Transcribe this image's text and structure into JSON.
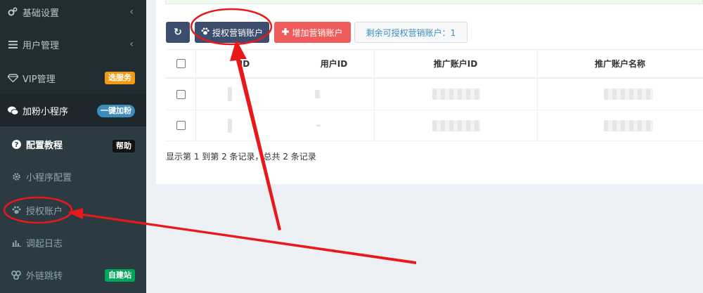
{
  "sidebar": {
    "items": [
      {
        "label": "基础设置",
        "icon": "gears-icon",
        "chevron": "‹"
      },
      {
        "label": "用户管理",
        "icon": "list-icon",
        "chevron": "‹"
      },
      {
        "label": "VIP管理",
        "icon": "diamond-icon",
        "badge": "选服务"
      },
      {
        "label": "加粉小程序",
        "icon": "wechat-icon",
        "badge": "一键加粉"
      }
    ],
    "sub_items": [
      {
        "label": "配置教程",
        "icon": "question-icon",
        "badge": "帮助"
      },
      {
        "label": "小程序配置",
        "icon": "gear-icon"
      },
      {
        "label": "授权账户",
        "icon": "paw-icon"
      },
      {
        "label": "调起日志",
        "icon": "bar-chart-icon"
      },
      {
        "label": "外链跳转",
        "icon": "link-icon",
        "badge": "自建站"
      }
    ]
  },
  "toolbar": {
    "refresh_icon": "↻",
    "auth_label": "授权营销账户",
    "add_label": "增加营销账户",
    "remaining_label": "剩余可授权营销账户：1"
  },
  "table": {
    "columns": [
      "ID",
      "用户ID",
      "推广账户ID",
      "推广账户名称"
    ],
    "rows": [
      {
        "id": "",
        "user_id": "",
        "account_id": "",
        "account_name": ""
      },
      {
        "id": "",
        "user_id": "",
        "account_id": "",
        "account_name": ""
      }
    ]
  },
  "footer": {
    "summary": "显示第 1 到第 2 条记录，总共 2 条记录"
  },
  "colors": {
    "sidebar_bg": "#222d32",
    "primary_button": "#3d4d6d",
    "danger_button": "#f05b5b",
    "annotation_red": "#e8181b"
  }
}
